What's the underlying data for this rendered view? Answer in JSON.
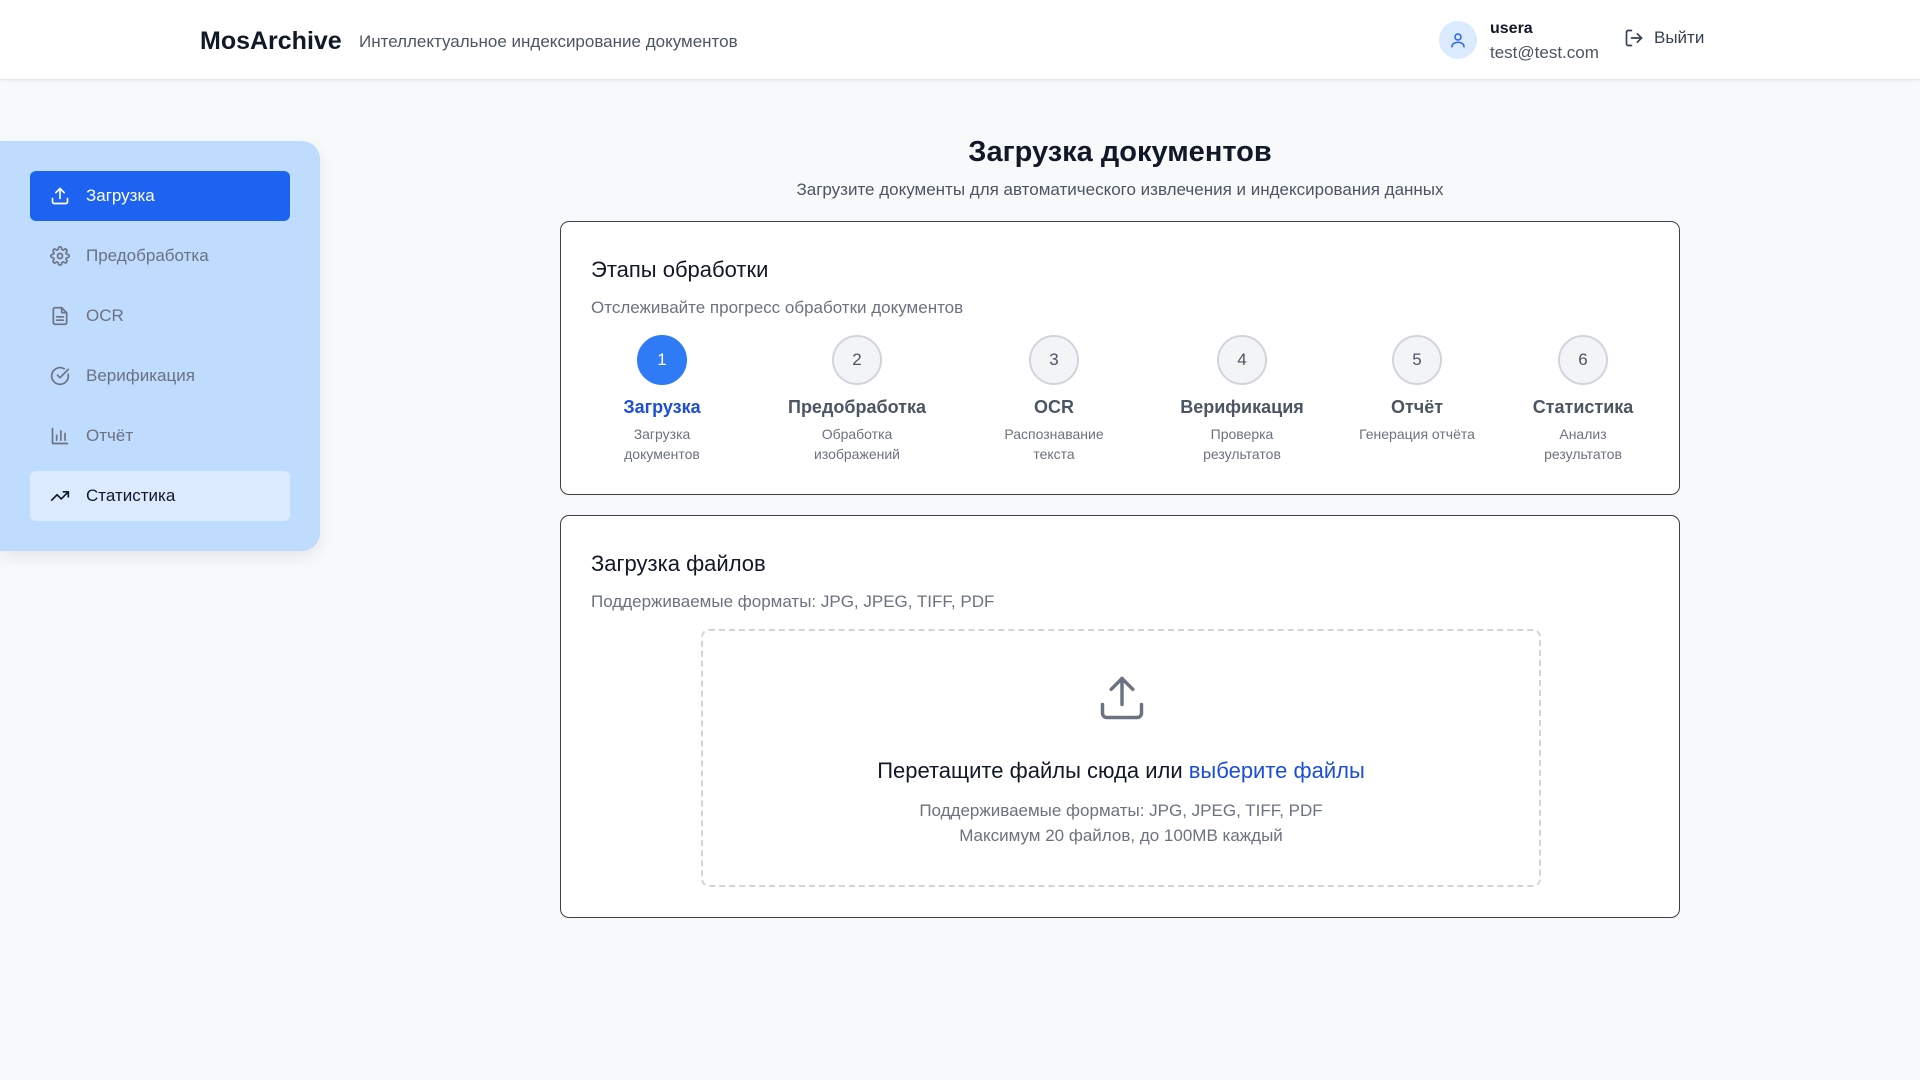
{
  "header": {
    "brand": "MosArchive",
    "tagline": "Интеллектуальное индексирование документов",
    "user_name": "usera",
    "user_email": "test@test.com",
    "logout_label": "Выйти"
  },
  "sidebar": {
    "items": [
      {
        "label": "Загрузка",
        "icon": "upload-icon",
        "state": "active"
      },
      {
        "label": "Предобработка",
        "icon": "gear-icon",
        "state": "disabled"
      },
      {
        "label": "OCR",
        "icon": "document-icon",
        "state": "disabled"
      },
      {
        "label": "Верификация",
        "icon": "check-circle-icon",
        "state": "disabled"
      },
      {
        "label": "Отчёт",
        "icon": "bar-chart-icon",
        "state": "disabled"
      },
      {
        "label": "Статистика",
        "icon": "trending-up-icon",
        "state": "hover"
      }
    ]
  },
  "main": {
    "title": "Загрузка документов",
    "subtitle": "Загрузите документы для автоматического извлечения и индексирования данных"
  },
  "stages": {
    "title": "Этапы обработки",
    "description": "Отслеживайте прогресс обработки документов",
    "steps": [
      {
        "number": "1",
        "title": "Загрузка",
        "desc": "Загрузка документов",
        "active": true
      },
      {
        "number": "2",
        "title": "Предобработка",
        "desc": "Обработка изображений",
        "active": false
      },
      {
        "number": "3",
        "title": "OCR",
        "desc": "Распознавание текста",
        "active": false
      },
      {
        "number": "4",
        "title": "Верификация",
        "desc": "Проверка результатов",
        "active": false
      },
      {
        "number": "5",
        "title": "Отчёт",
        "desc": "Генерация отчёта",
        "active": false
      },
      {
        "number": "6",
        "title": "Статистика",
        "desc": "Анализ результатов",
        "active": false
      }
    ]
  },
  "upload": {
    "title": "Загрузка файлов",
    "description": "Поддерживаемые форматы: JPG, JPEG, TIFF, PDF",
    "drop_text": "Перетащите файлы сюда или ",
    "drop_link": "выберите файлы",
    "formats": "Поддерживаемые форматы: JPG, JPEG, TIFF, PDF",
    "limits": "Максимум 20 файлов, до 100MB каждый"
  },
  "colors": {
    "accent": "#1d62f0",
    "sidebar_bg": "#bfdbfe",
    "link": "#1d4ed8"
  }
}
